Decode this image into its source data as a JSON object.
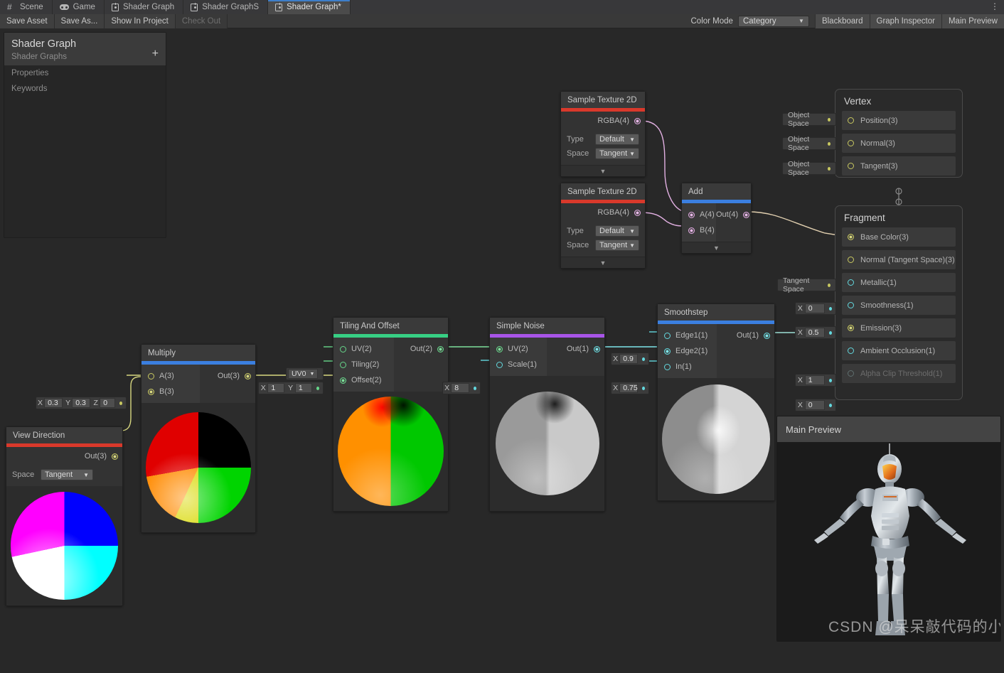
{
  "tabs": [
    {
      "label": "Scene",
      "icon": "grid-icon",
      "active": false
    },
    {
      "label": "Game",
      "icon": "gamepad-icon",
      "active": false
    },
    {
      "label": "Shader Graph",
      "icon": "shadergraph-icon",
      "active": false
    },
    {
      "label": "Shader GraphS",
      "icon": "shadergraph-icon",
      "active": false
    },
    {
      "label": "Shader Graph*",
      "icon": "shadergraph-icon",
      "active": true
    }
  ],
  "tab_menu_icon": "kebab-menu-icon",
  "toolbar": {
    "save_asset": "Save Asset",
    "save_as": "Save As...",
    "show_in_project": "Show In Project",
    "check_out": "Check Out",
    "color_mode_label": "Color Mode",
    "color_mode_value": "Category",
    "blackboard": "Blackboard",
    "graph_inspector": "Graph Inspector",
    "main_preview": "Main Preview"
  },
  "blackboard": {
    "title": "Shader Graph",
    "subtitle": "Shader Graphs",
    "add_icon": "plus-icon",
    "rows": [
      "Properties",
      "Keywords"
    ]
  },
  "nodes": {
    "sample_texture_1": {
      "title": "Sample Texture 2D",
      "accent": "#d9392b",
      "out_port": "RGBA(4)",
      "type_label": "Type",
      "type_value": "Default",
      "space_label": "Space",
      "space_value": "Tangent",
      "expander_icon": "chevron-down-icon"
    },
    "sample_texture_2": {
      "title": "Sample Texture 2D",
      "accent": "#d9392b",
      "out_port": "RGBA(4)",
      "type_label": "Type",
      "type_value": "Default",
      "space_label": "Space",
      "space_value": "Tangent",
      "expander_icon": "chevron-down-icon"
    },
    "add": {
      "title": "Add",
      "accent": "#3b7fe0",
      "in_ports": [
        "A(4)",
        "B(4)"
      ],
      "out_port": "Out(4)",
      "expander_icon": "chevron-down-icon"
    },
    "multiply": {
      "title": "Multiply",
      "accent": "#3b7fe0",
      "in_ports": [
        "A(3)",
        "B(3)"
      ],
      "out_port": "Out(3)"
    },
    "view_direction": {
      "title": "View Direction",
      "accent": "#d9392b",
      "out_port": "Out(3)",
      "space_label": "Space",
      "space_value": "Tangent"
    },
    "tiling_and_offset": {
      "title": "Tiling And Offset",
      "accent": "#37cf84",
      "in_ports": [
        "UV(2)",
        "Tiling(2)",
        "Offset(2)"
      ],
      "out_port": "Out(2)"
    },
    "simple_noise": {
      "title": "Simple Noise",
      "accent": "#a855e8",
      "in_ports": [
        "UV(2)",
        "Scale(1)"
      ],
      "out_port": "Out(1)"
    },
    "smoothstep": {
      "title": "Smoothstep",
      "accent": "#3b7fe0",
      "in_ports": [
        "Edge1(1)",
        "Edge2(1)",
        "In(1)"
      ],
      "out_port": "Out(1)"
    }
  },
  "field_chips": {
    "multiply_a": {
      "axes": [
        "X",
        "Y",
        "Z"
      ],
      "values": [
        "0.3",
        "0.3",
        "0"
      ]
    },
    "tiling": {
      "axes": [
        "X",
        "Y"
      ],
      "values": [
        "1",
        "1"
      ]
    },
    "uv_channel": "UV0",
    "noise_scale": {
      "axes": [
        "X"
      ],
      "values": [
        "8"
      ]
    },
    "smoothstep_edge1": {
      "axes": [
        "X"
      ],
      "values": [
        "0.9"
      ]
    },
    "smoothstep_in": {
      "axes": [
        "X"
      ],
      "values": [
        "0.75"
      ]
    }
  },
  "vertex_stack": {
    "title": "Vertex",
    "blocks": [
      {
        "label": "Position(3)",
        "chip": "Object Space",
        "connected": false
      },
      {
        "label": "Normal(3)",
        "chip": "Object Space",
        "connected": false
      },
      {
        "label": "Tangent(3)",
        "chip": "Object Space",
        "connected": false
      }
    ]
  },
  "fragment_stack": {
    "title": "Fragment",
    "blocks": [
      {
        "label": "Base Color(3)",
        "chip": null,
        "connected": true
      },
      {
        "label": "Normal (Tangent Space)(3)",
        "chip": "Tangent Space",
        "connected": false
      },
      {
        "label": "Metallic(1)",
        "chip": null,
        "value": "0",
        "axis": "X",
        "connected": false
      },
      {
        "label": "Smoothness(1)",
        "chip": null,
        "value": "0.5",
        "axis": "X",
        "connected": false
      },
      {
        "label": "Emission(3)",
        "chip": null,
        "connected": true
      },
      {
        "label": "Ambient Occlusion(1)",
        "chip": null,
        "value": "1",
        "axis": "X",
        "connected": false
      },
      {
        "label": "Alpha Clip Threshold(1)",
        "chip": null,
        "value": "0",
        "axis": "X",
        "connected": false,
        "disabled": true
      }
    ]
  },
  "main_preview": {
    "title": "Main Preview",
    "watermark": "CSDN @呆呆敲代码的小Y"
  },
  "colors": {
    "accent_blue": "#3b7fe0",
    "accent_red": "#d9392b",
    "accent_green": "#37cf84",
    "accent_purple": "#a855e8",
    "edge_vector4": "#e2b0e2",
    "edge_vector3": "#d8d880",
    "edge_vector2": "#7de09a",
    "edge_vector1": "#7ee6ea"
  }
}
